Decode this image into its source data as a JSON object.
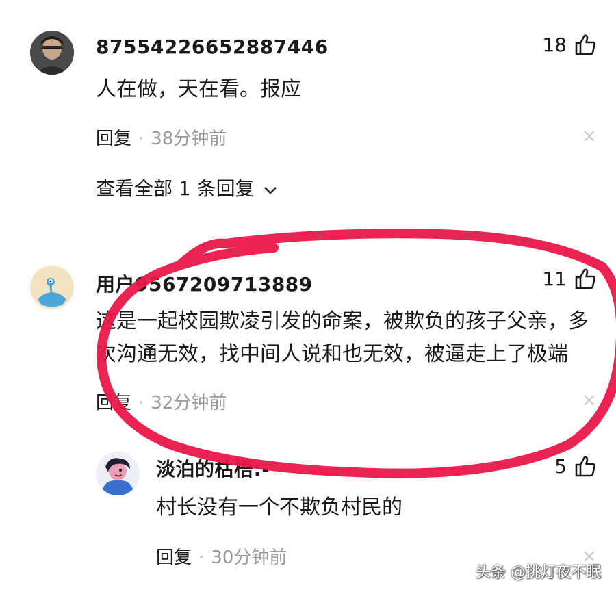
{
  "comments": [
    {
      "username": "87554226652887446",
      "likes": "18",
      "content": "人在做，天在看。报应",
      "reply_label": "回复",
      "separator": "·",
      "time": "38分钟前",
      "close": "×",
      "view_replies": "查看全部 1 条回复"
    },
    {
      "username": "用户9567209713889",
      "likes": "11",
      "content_lines": [
        "这是一起校园欺凌引发的命案，被欺负的孩子父亲，多",
        "次沟通无效，找中间人说和也无效，被逼走上了极端"
      ],
      "reply_label": "回复",
      "separator": "·",
      "time": "32分钟前",
      "close": "×"
    },
    {
      "username": "淡泊的枯梧:-",
      "likes": "5",
      "content": "村长没有一个不欺负村民的",
      "reply_label": "回复",
      "separator": "·",
      "time": "30分钟前",
      "close": "×"
    }
  ],
  "watermark": "头条 @挑灯夜不眠",
  "colors": {
    "annotation": "#e8184a",
    "muted": "#9a9a9a"
  }
}
